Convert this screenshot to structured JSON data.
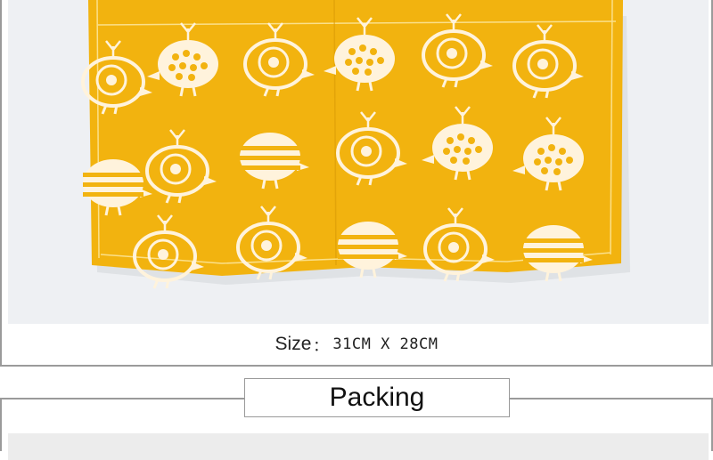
{
  "size_caption": {
    "label": "Size",
    "separator": "：",
    "value": "31CM X 28CM"
  },
  "section_title": "Packing",
  "colors": {
    "fabric": "#f2b30f",
    "fabric_shadow": "#d99a05",
    "print": "#fff3dc",
    "backdrop": "#eef0f3",
    "border": "#9a9a9a"
  },
  "illustration": {
    "subject": "yellow muslin bib with white cartoon bird print"
  }
}
